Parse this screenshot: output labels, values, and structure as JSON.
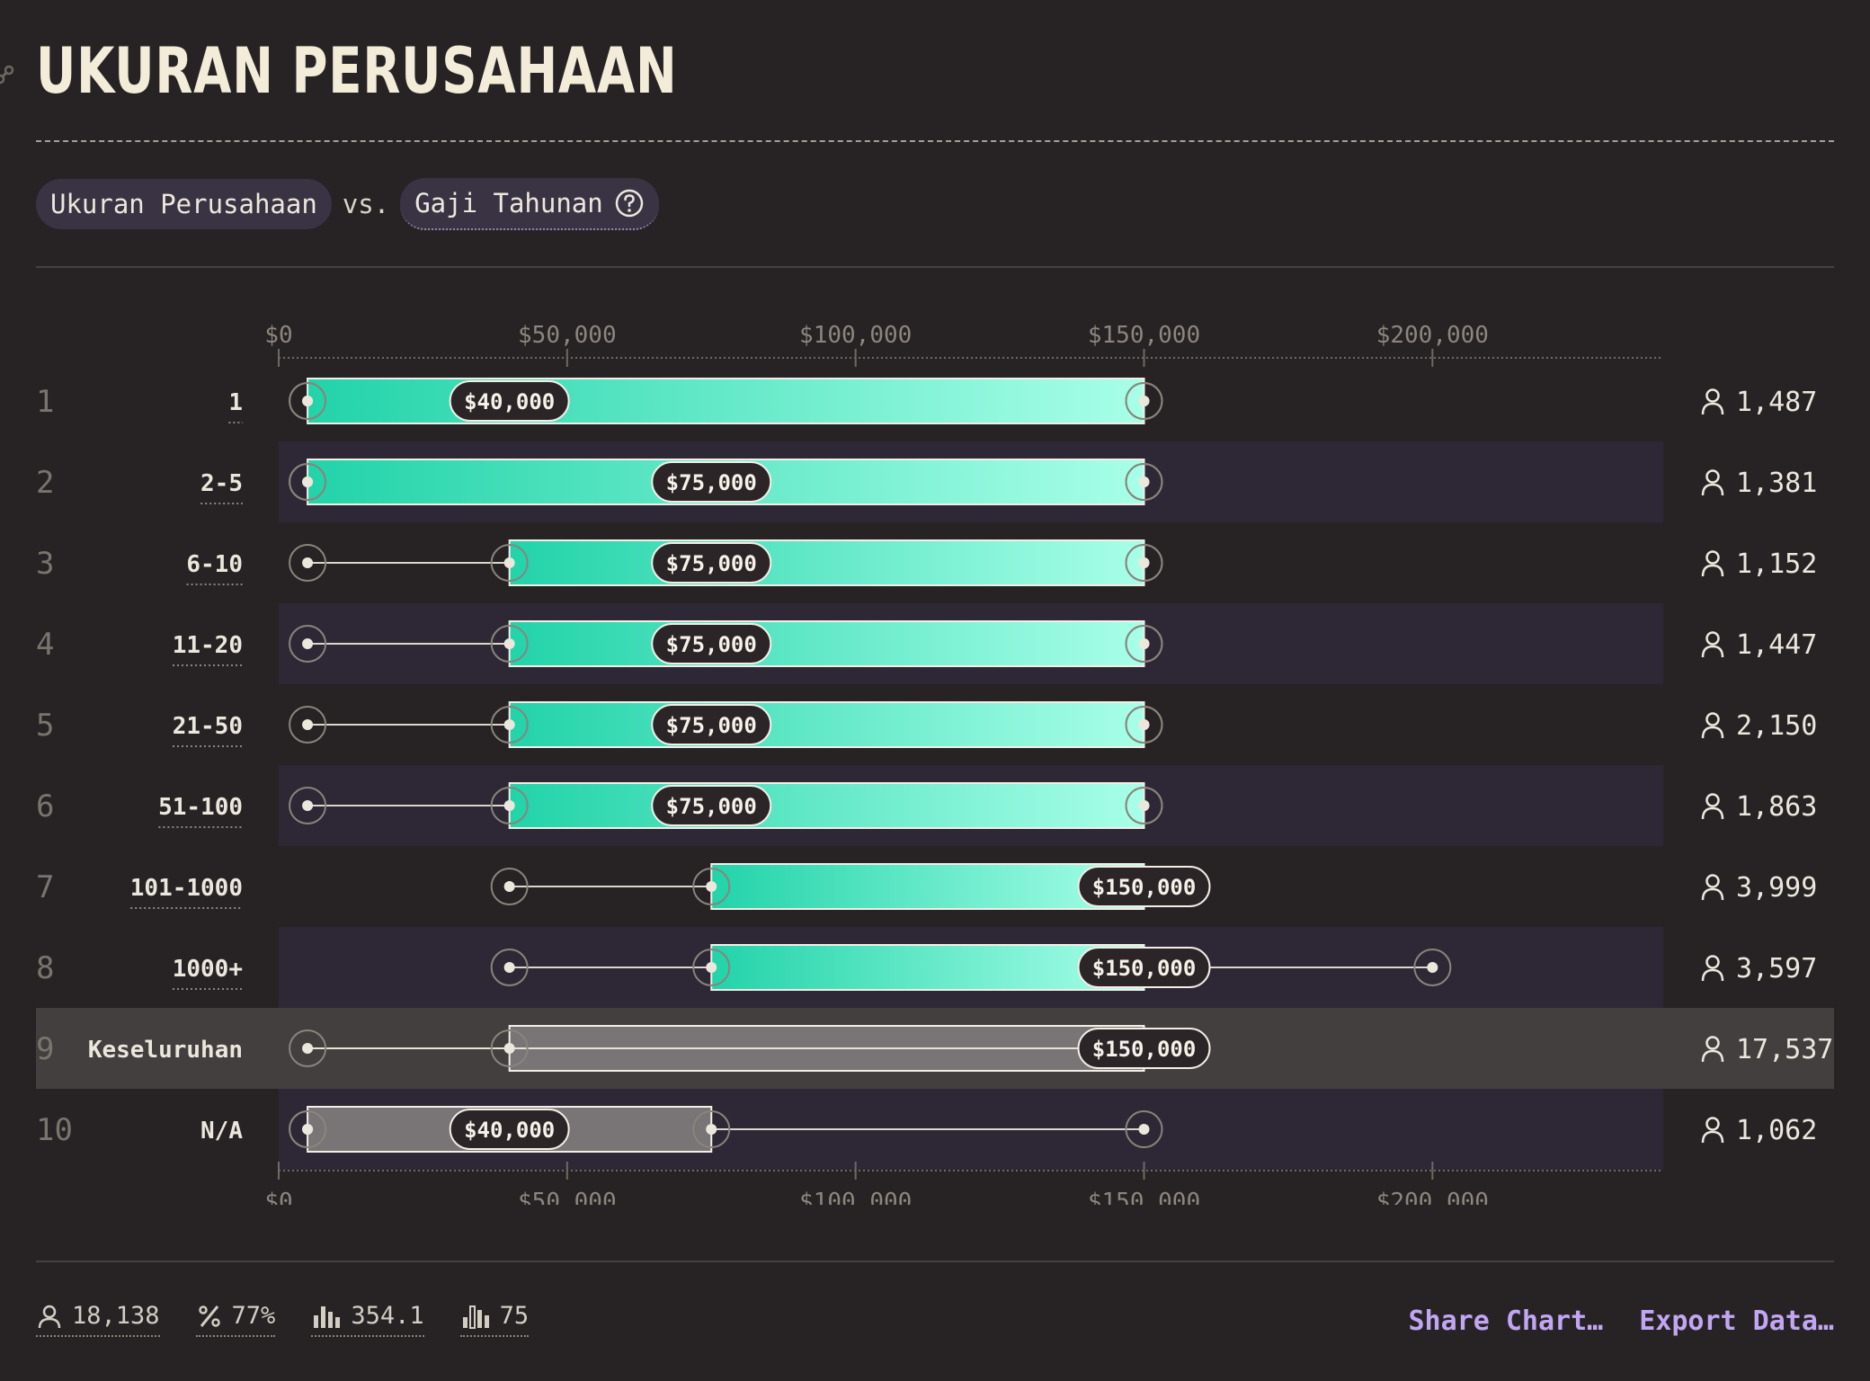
{
  "header": {
    "title": "UKURAN PERUSAHAAN",
    "dimension_pill": "Ukuran Perusahaan",
    "vs_label": "vs.",
    "metric_pill": "Gaji Tahunan"
  },
  "colors": {
    "background": "#272325",
    "bar_start": "#22d3a9",
    "bar_end": "#a8ffe8",
    "overall_bar": "#797475",
    "row_band": "#2e2836",
    "highlight_row": "#433f3f",
    "link": "#c3a6f3"
  },
  "chart_data": {
    "type": "box",
    "xlim": [
      0,
      240000
    ],
    "ticks": [
      0,
      50000,
      100000,
      150000,
      200000
    ],
    "tick_labels": [
      "$0",
      "$50,000",
      "$100,000",
      "$150,000",
      "$200,000"
    ],
    "rows": [
      {
        "rank": "1",
        "label": "1",
        "min": 5000,
        "q1": 5000,
        "median": 40000,
        "q3": 150000,
        "max": 150000,
        "median_label": "$40,000",
        "count": "1,487"
      },
      {
        "rank": "2",
        "label": "2-5",
        "min": 5000,
        "q1": 5000,
        "median": 75000,
        "q3": 150000,
        "max": 150000,
        "median_label": "$75,000",
        "count": "1,381"
      },
      {
        "rank": "3",
        "label": "6-10",
        "min": 5000,
        "q1": 40000,
        "median": 75000,
        "q3": 150000,
        "max": 150000,
        "median_label": "$75,000",
        "count": "1,152"
      },
      {
        "rank": "4",
        "label": "11-20",
        "min": 5000,
        "q1": 40000,
        "median": 75000,
        "q3": 150000,
        "max": 150000,
        "median_label": "$75,000",
        "count": "1,447"
      },
      {
        "rank": "5",
        "label": "21-50",
        "min": 5000,
        "q1": 40000,
        "median": 75000,
        "q3": 150000,
        "max": 150000,
        "median_label": "$75,000",
        "count": "2,150"
      },
      {
        "rank": "6",
        "label": "51-100",
        "min": 5000,
        "q1": 40000,
        "median": 75000,
        "q3": 150000,
        "max": 150000,
        "median_label": "$75,000",
        "count": "1,863"
      },
      {
        "rank": "7",
        "label": "101-1000",
        "min": 40000,
        "q1": 75000,
        "median": 150000,
        "q3": 150000,
        "max": 150000,
        "median_label": "$150,000",
        "count": "3,999"
      },
      {
        "rank": "8",
        "label": "1000+",
        "min": 40000,
        "q1": 75000,
        "median": 150000,
        "q3": 150000,
        "max": 200000,
        "median_label": "$150,000",
        "count": "3,597"
      },
      {
        "rank": "9",
        "label": "Keseluruhan",
        "min": 5000,
        "q1": 40000,
        "median": 150000,
        "q3": 150000,
        "max": 150000,
        "median_label": "$150,000",
        "count": "17,537",
        "overall": true
      },
      {
        "rank": "10",
        "label": "N/A",
        "min": 5000,
        "q1": 5000,
        "median": 40000,
        "q3": 75000,
        "max": 150000,
        "median_label": "$40,000",
        "count": "1,062",
        "gray": true
      }
    ]
  },
  "footer": {
    "respondents": "18,138",
    "percent": "77%",
    "stat3": "354.1",
    "stat4": "75",
    "share_label": "Share Chart…",
    "export_label": "Export Data…"
  }
}
